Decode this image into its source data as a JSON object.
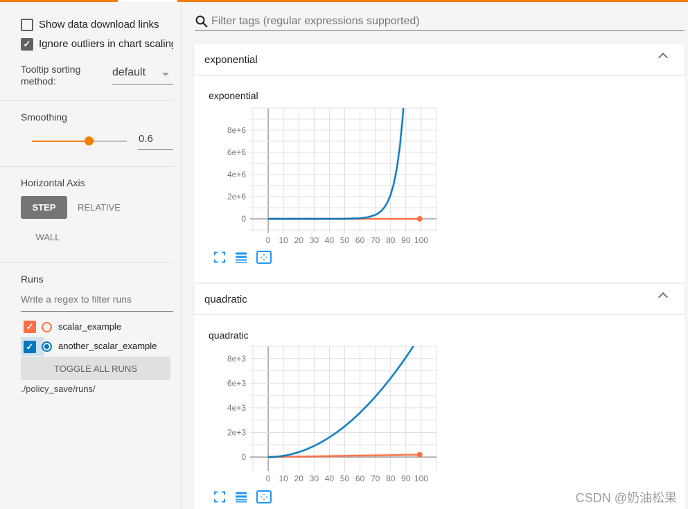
{
  "sidebar": {
    "show_download_links": {
      "label": "Show data download links",
      "checked": false
    },
    "ignore_outliers": {
      "label": "Ignore outliers in chart scaling",
      "checked": true
    },
    "tooltip_sorting": {
      "label_line1": "Tooltip sorting",
      "label_line2": "method:",
      "value": "default"
    },
    "smoothing": {
      "label": "Smoothing",
      "value": "0.6",
      "fraction": 0.6
    },
    "horizontal_axis": {
      "label": "Horizontal Axis",
      "options": [
        "STEP",
        "RELATIVE",
        "WALL"
      ],
      "selected": "STEP"
    },
    "runs": {
      "label": "Runs",
      "filter_placeholder": "Write a regex to filter runs",
      "items": [
        {
          "name": "scalar_example",
          "checked": true,
          "color": "#ff7043"
        },
        {
          "name": "another_scalar_example",
          "checked": true,
          "color": "#0077bb"
        }
      ],
      "toggle_all_label": "TOGGLE ALL RUNS",
      "logdir": "./policy_save/runs/"
    }
  },
  "main": {
    "search_placeholder": "Filter tags (regular expressions supported)",
    "cards": [
      {
        "header": "exponential"
      },
      {
        "header": "quadratic"
      }
    ]
  },
  "chart_data": [
    {
      "type": "line",
      "title": "exponential",
      "xlim": [
        -10,
        110
      ],
      "ylim": [
        -1000000,
        10000000
      ],
      "x_ticks": [
        "0",
        "10",
        "20",
        "30",
        "40",
        "50",
        "60",
        "70",
        "80",
        "90",
        "100"
      ],
      "y_ticks": [
        "0",
        "2e+6",
        "4e+6",
        "6e+6",
        "8e+6"
      ],
      "grid": true,
      "series": [
        {
          "name": "another_scalar_example",
          "color": "#0077bb",
          "x": [
            0,
            10,
            20,
            30,
            40,
            50,
            60,
            65,
            70,
            72,
            74,
            76,
            78,
            80,
            82,
            84,
            86,
            88,
            90
          ],
          "y": [
            1,
            6,
            38,
            237,
            1470,
            9100,
            56348,
            140210,
            348889,
            502400,
            723456,
            1041777,
            1500159,
            2160228,
            3110729,
            4479450,
            6450408,
            9288588,
            13375568
          ]
        },
        {
          "name": "scalar_example",
          "color": "#ff7043",
          "x": [
            0,
            99
          ],
          "y": [
            0,
            198
          ]
        }
      ]
    },
    {
      "type": "line",
      "title": "quadratic",
      "xlim": [
        -10,
        110
      ],
      "ylim": [
        -900,
        9000
      ],
      "x_ticks": [
        "0",
        "10",
        "20",
        "30",
        "40",
        "50",
        "60",
        "70",
        "80",
        "90",
        "100"
      ],
      "y_ticks": [
        "0",
        "2e+3",
        "4e+3",
        "6e+3",
        "8e+3"
      ],
      "grid": true,
      "series": [
        {
          "name": "another_scalar_example",
          "color": "#0077bb",
          "x": [
            0,
            5,
            10,
            15,
            20,
            25,
            30,
            35,
            40,
            45,
            50,
            55,
            60,
            65,
            70,
            75,
            80,
            85,
            90,
            95,
            99
          ],
          "y": [
            0,
            25,
            100,
            225,
            400,
            625,
            900,
            1225,
            1600,
            2025,
            2500,
            3025,
            3600,
            4225,
            4900,
            5625,
            6400,
            7225,
            8100,
            9025,
            9801
          ]
        },
        {
          "name": "scalar_example",
          "color": "#ff7043",
          "x": [
            0,
            99
          ],
          "y": [
            0,
            198
          ]
        }
      ]
    }
  ],
  "watermark": "CSDN @奶油松果"
}
